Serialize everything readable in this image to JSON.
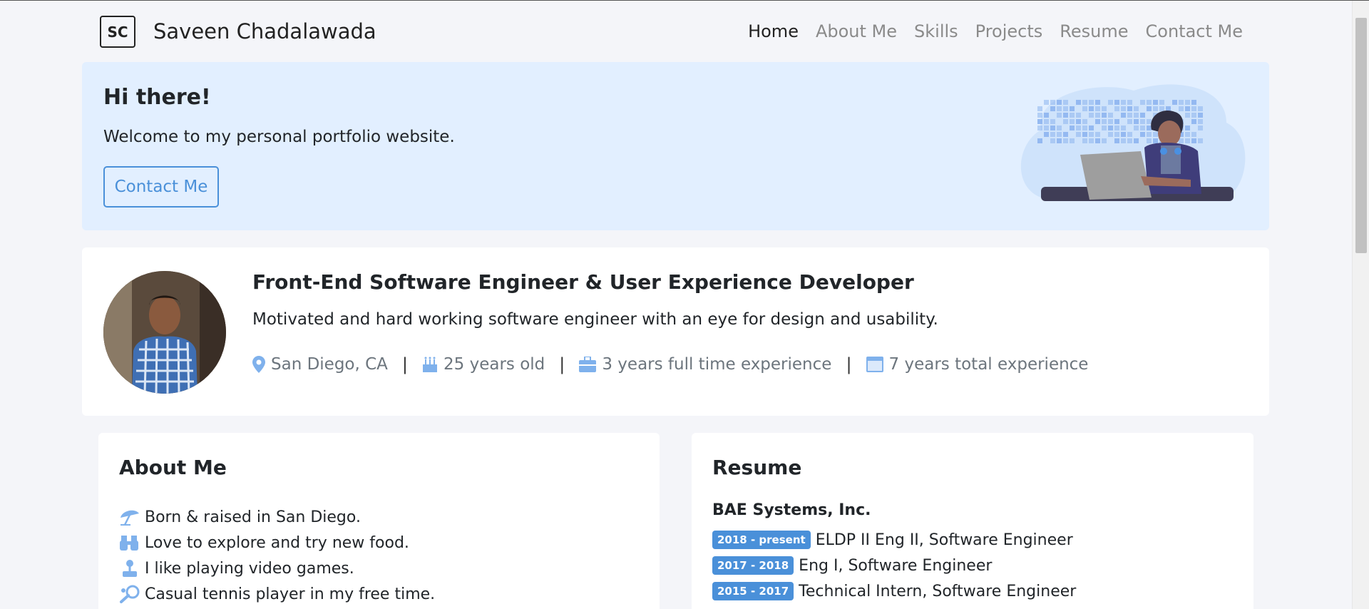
{
  "navbar": {
    "logo_text": "SC",
    "brand": "Saveen Chadalawada",
    "links": [
      {
        "label": "Home",
        "active": true
      },
      {
        "label": "About Me",
        "active": false
      },
      {
        "label": "Skills",
        "active": false
      },
      {
        "label": "Projects",
        "active": false
      },
      {
        "label": "Resume",
        "active": false
      },
      {
        "label": "Contact Me",
        "active": false
      }
    ]
  },
  "hero": {
    "title": "Hi there!",
    "subtitle": "Welcome to my personal portfolio website.",
    "button_label": "Contact Me",
    "background": "#e2efff"
  },
  "profile": {
    "title": "Front-End Software Engineer & User Experience Developer",
    "description": "Motivated and hard working software engineer with an eye for design and usability.",
    "facts": [
      {
        "icon": "map-pin-icon",
        "text": "San Diego, CA"
      },
      {
        "icon": "birthday-cake-icon",
        "text": "25 years old"
      },
      {
        "icon": "briefcase-icon",
        "text": "3 years full time experience"
      },
      {
        "icon": "window-icon",
        "text": "7 years total experience"
      }
    ],
    "separator": "|"
  },
  "about": {
    "title": "About Me",
    "items": [
      {
        "icon": "beach-umbrella-icon",
        "text": "Born & raised in San Diego."
      },
      {
        "icon": "binoculars-icon",
        "text": "Love to explore and try new food."
      },
      {
        "icon": "joystick-icon",
        "text": "I like playing video games."
      },
      {
        "icon": "tennis-racket-icon",
        "text": "Casual tennis player in my free time."
      }
    ]
  },
  "resume": {
    "title": "Resume",
    "company": "BAE Systems, Inc.",
    "jobs": [
      {
        "dates": "2018 - present",
        "role": "ELDP II Eng II, Software Engineer"
      },
      {
        "dates": "2017 - 2018",
        "role": "Eng I, Software Engineer"
      },
      {
        "dates": "2015 - 2017",
        "role": "Technical Intern, Software Engineer"
      }
    ]
  },
  "colors": {
    "accent": "#4a90d9",
    "icon": "#7fb1ec",
    "page_bg": "#f4f5f9"
  }
}
